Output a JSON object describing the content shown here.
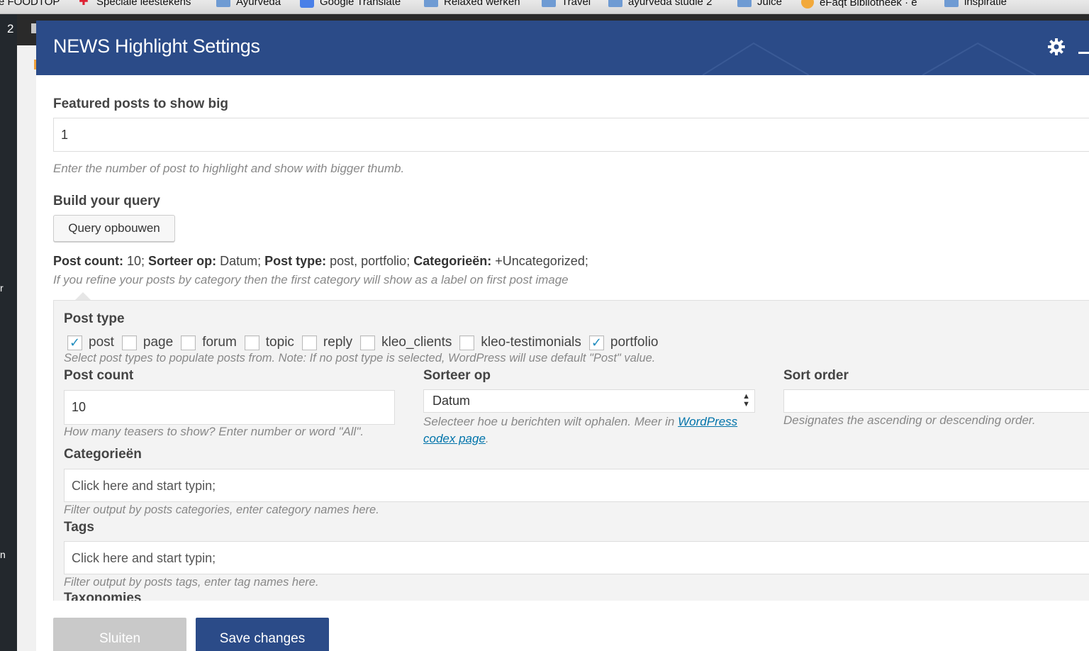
{
  "bookmarks": [
    {
      "label": "e FOODTOP",
      "icon": "none"
    },
    {
      "label": "Speciale leestekens",
      "icon": "lifebuoy-icon"
    },
    {
      "label": "Ayurveda",
      "icon": "folder-icon"
    },
    {
      "label": "Google Translate",
      "icon": "translate-icon"
    },
    {
      "label": "Relaxed werken",
      "icon": "folder-icon"
    },
    {
      "label": "Travel",
      "icon": "folder-icon"
    },
    {
      "label": "ayurveda studie 2",
      "icon": "folder-icon"
    },
    {
      "label": "Juice",
      "icon": "folder-icon"
    },
    {
      "label": "eFaqt Bibliotheek · e",
      "icon": "favicon-icon"
    },
    {
      "label": "inspiratie",
      "icon": "folder-icon"
    }
  ],
  "admin": {
    "badge": "2",
    "marks": [
      "r",
      "n"
    ]
  },
  "modal": {
    "title": "NEWS Highlight Settings",
    "featured": {
      "label": "Featured posts to show big",
      "value": "1",
      "hint": "Enter the number of post to highlight and show with bigger thumb."
    },
    "query": {
      "label": "Build your query",
      "button": "Query opbouwen",
      "summary": {
        "count_label": "Post count:",
        "count_value": " 10;",
        "sort_label": "Sorteer op:",
        "sort_value": " Datum;",
        "type_label": "Post type:",
        "type_value": " post, portfolio;",
        "cat_label": "Categorieën:",
        "cat_value": " +Uncategorized;"
      },
      "summary_hint": "If you refine your posts by category then the first category will show as a label on first post image"
    },
    "panel": {
      "post_type_label": "Post type",
      "post_types": [
        {
          "label": "post",
          "checked": true
        },
        {
          "label": "page",
          "checked": false
        },
        {
          "label": "forum",
          "checked": false
        },
        {
          "label": "topic",
          "checked": false
        },
        {
          "label": "reply",
          "checked": false
        },
        {
          "label": "kleo_clients",
          "checked": false
        },
        {
          "label": "kleo-testimonials",
          "checked": false
        },
        {
          "label": "portfolio",
          "checked": true
        }
      ],
      "post_type_hint": "Select post types to populate posts from. Note: If no post type is selected, WordPress will use default \"Post\" value.",
      "post_count_label": "Post count",
      "post_count_value": "10",
      "post_count_hint": "How many teasers to show? Enter number or word \"All\".",
      "sort_by_label": "Sorteer op",
      "sort_by_value": "Datum",
      "sort_by_hint_prefix": "Selecteer hoe u berichten wilt ophalen. Meer in ",
      "sort_by_hint_link_1": "WordPress",
      "sort_by_hint_link_2": "codex page",
      "sort_by_hint_suffix": ".",
      "sort_order_label": "Sort order",
      "sort_order_hint": "Designates the ascending or descending order.",
      "categories_label": "Categorieën",
      "categories_placeholder": "Click here and start typin;",
      "categories_hint": "Filter output by posts categories, enter category names here.",
      "tags_label": "Tags",
      "tags_placeholder": "Click here and start typin;",
      "tags_hint": "Filter output by posts tags, enter tag names here.",
      "taxonomies_label": "Taxonomies"
    },
    "footer": {
      "close_label": "Sluiten",
      "save_label": "Save changes"
    }
  },
  "colors": {
    "header": "#2b4b88",
    "link": "#0073aa",
    "check": "#1e8cbe",
    "close_button": "#c9c9c9"
  }
}
